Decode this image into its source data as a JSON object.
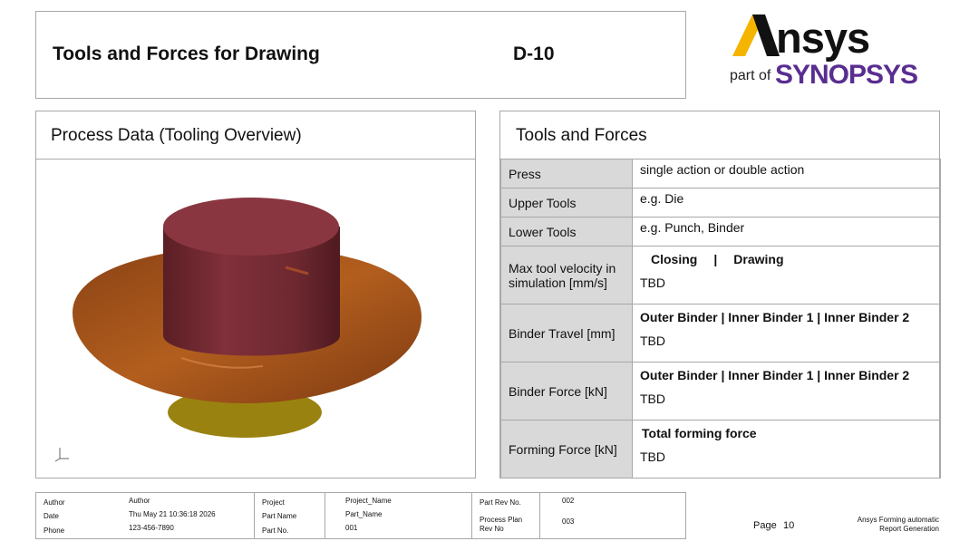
{
  "title": {
    "text": "Tools and Forces for Drawing",
    "code": "D-10"
  },
  "logo": {
    "ansys": "Ansys",
    "part_of": "part of",
    "synopsys": "SYNOPSYS"
  },
  "left_panel": {
    "heading": "Process Data (Tooling Overview)"
  },
  "right_panel": {
    "heading": "Tools and Forces",
    "rows": [
      {
        "label": "Press",
        "value": "single action or double action"
      },
      {
        "label": "Upper Tools",
        "value": "e.g. Die"
      },
      {
        "label": "Lower Tools",
        "value": "e.g. Punch, Binder"
      },
      {
        "label": "Max tool velocity in simulation [mm/s]",
        "col1": "Closing",
        "sep": "|",
        "col2": "Drawing",
        "value": "TBD"
      },
      {
        "label": "Binder Travel [mm]",
        "header": "Outer Binder | Inner Binder 1 | Inner Binder 2",
        "value": "TBD"
      },
      {
        "label": "Binder Force [kN]",
        "header": "Outer Binder | Inner Binder 1 | Inner Binder 2",
        "value": "TBD"
      },
      {
        "label": "Forming Force [kN]",
        "header": "Total forming force",
        "value": "TBD"
      }
    ]
  },
  "footer": {
    "author_label": "Author",
    "author": "Author",
    "date_label": "Date",
    "date": "Thu May 21 10:36:18 2026",
    "phone_label": "Phone",
    "phone": "123-456-7890",
    "project_label": "Project",
    "project": "Project_Name",
    "part_name_label": "Part Name",
    "part_name": "Part_Name",
    "part_no_label": "Part No.",
    "part_no": "001",
    "part_rev_label": "Part Rev No.",
    "part_rev": "002",
    "plan_rev_label_1": "Process Plan",
    "plan_rev_label_2": "Rev No",
    "plan_rev": "003",
    "page_label": "Page",
    "page": "10",
    "generator_1": "Ansys Forming automatic",
    "generator_2": "Report Generation"
  },
  "colors": {
    "cylinder": "#7a2a30",
    "flange": "#a8561c",
    "base": "#b59a10",
    "label_bg": "#d9d9d9",
    "brand_yellow": "#f5b400",
    "brand_purple": "#5a2d91"
  }
}
